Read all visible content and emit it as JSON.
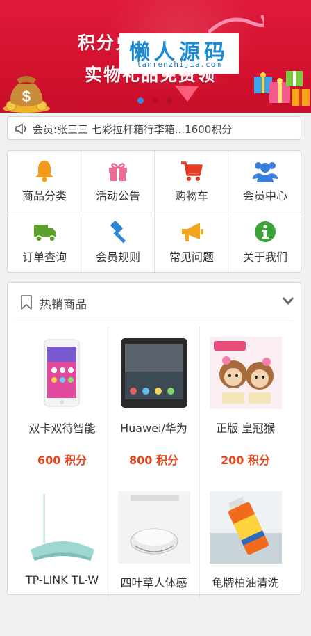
{
  "banner": {
    "line1": "积分兑换节",
    "line2": "实物礼品免费领",
    "watermark_title": "懒人源码",
    "watermark_sub": "lanrenzhijia.com",
    "dots": 3,
    "active_dot": 0
  },
  "notice": {
    "icon": "speaker-icon",
    "text": "会员:张三三 七彩拉杆箱行李箱...1600积分"
  },
  "menu": {
    "items": [
      {
        "label": "商品分类",
        "icon": "bell-icon",
        "color": "#f39a1b"
      },
      {
        "label": "活动公告",
        "icon": "gift-icon",
        "color": "#f06b93"
      },
      {
        "label": "购物车",
        "icon": "cart-icon",
        "color": "#e33b25"
      },
      {
        "label": "会员中心",
        "icon": "users-icon",
        "color": "#3a7fd9"
      },
      {
        "label": "订单查询",
        "icon": "truck-icon",
        "color": "#59a12a"
      },
      {
        "label": "会员规则",
        "icon": "gavel-icon",
        "color": "#2d86d8"
      },
      {
        "label": "常见问题",
        "icon": "bullhorn-icon",
        "color": "#f2a51d"
      },
      {
        "label": "关于我们",
        "icon": "info-icon",
        "color": "#3aa33a"
      }
    ]
  },
  "hot": {
    "title": "热销商品",
    "products": [
      {
        "name": "双卡双待智能",
        "price": "600 积分"
      },
      {
        "name": "Huawei/华为",
        "price": "800 积分"
      },
      {
        "name": "正版 皇冠猴",
        "price": "200 积分"
      },
      {
        "name": "TP-LINK TL-W",
        "price": ""
      },
      {
        "name": "四叶草人体感",
        "price": ""
      },
      {
        "name": "龟牌柏油清洗",
        "price": ""
      }
    ]
  },
  "colors": {
    "banner_red": "#d3122f",
    "price_orange": "#e5451a",
    "active_dot_blue": "#2f8ee0"
  }
}
